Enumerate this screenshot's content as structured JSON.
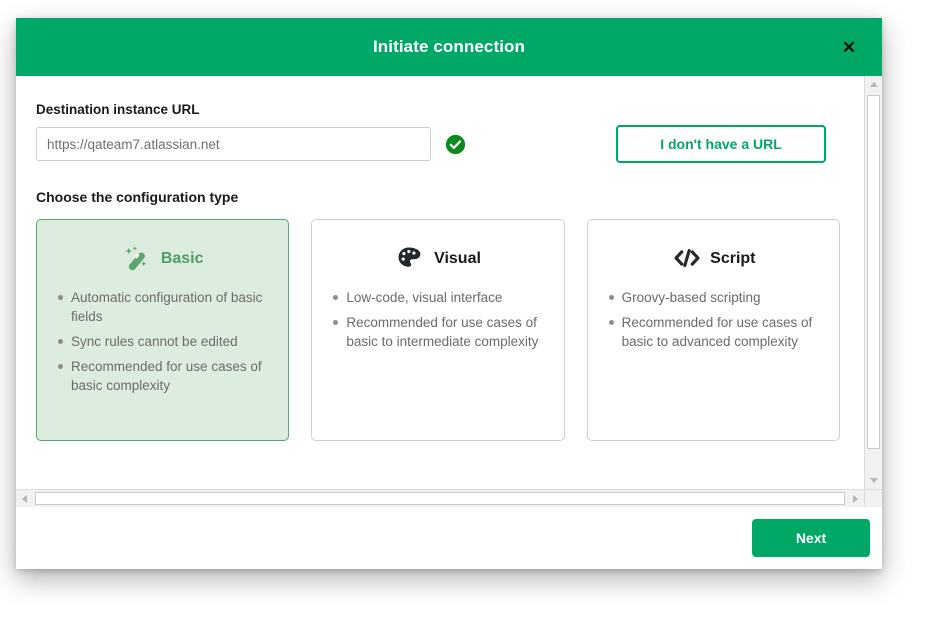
{
  "dialog": {
    "title": "Initiate connection",
    "close_icon": "close-icon",
    "close_label": "✕"
  },
  "form": {
    "url_label": "Destination instance URL",
    "url_value": "https://qateam7.atlassian.net",
    "url_placeholder": "https://qateam7.atlassian.net",
    "url_valid_icon": "check-circle-icon",
    "no_url_button": "I don't have a URL",
    "section_label": "Choose the configuration type"
  },
  "cards": [
    {
      "id": "basic",
      "title": "Basic",
      "icon": "magic-wand-icon",
      "selected": true,
      "bullets": [
        "Automatic configuration of basic fields",
        "Sync rules cannot be edited",
        "Recommended for use cases of basic complexity"
      ]
    },
    {
      "id": "visual",
      "title": "Visual",
      "icon": "palette-icon",
      "selected": false,
      "bullets": [
        "Low-code, visual interface",
        "Recommended for use cases of basic to intermediate complexity"
      ]
    },
    {
      "id": "script",
      "title": "Script",
      "icon": "code-brackets-icon",
      "selected": false,
      "bullets": [
        "Groovy-based scripting",
        "Recommended for use cases of basic to advanced complexity"
      ]
    }
  ],
  "footer": {
    "next_button": "Next"
  },
  "colors": {
    "brand_green": "#00a866",
    "card_selected_bg": "#dcedde",
    "card_selected_border": "#5aa86f",
    "check_green": "#0b8a1e",
    "muted_text": "#6b6b6b"
  }
}
